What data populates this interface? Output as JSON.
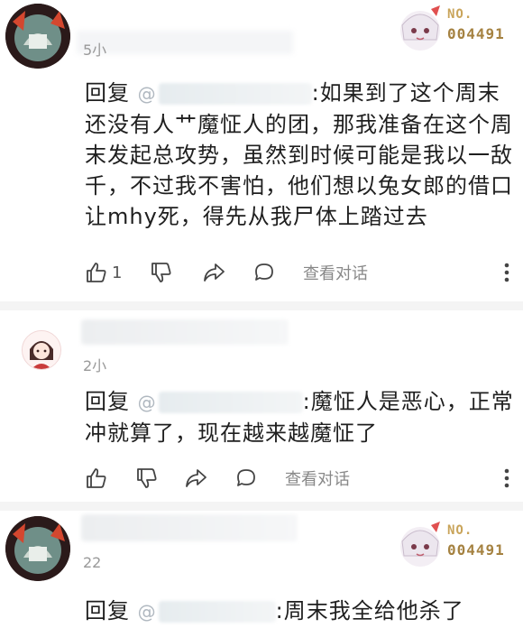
{
  "comments": [
    {
      "time": "5小",
      "badge": {
        "no": "NO.",
        "num": "004491"
      },
      "reply_prefix": "回复",
      "mention_sep": ":",
      "lines": [
        "如果到了这个周末",
        "还没有人艹魔怔人的团，那我准备在这个周",
        "末发起总攻势，虽然到时候可能是我以一敌",
        "千，不过我不害怕，他们想以兔女郎的借口",
        "让mhy死，得先从我尸体上踏过去"
      ],
      "like_count": "1",
      "view_dialog": "查看对话"
    },
    {
      "time": "2小",
      "reply_prefix": "回复",
      "mention_sep": ":",
      "lines": [
        "魔怔人是恶心，正常",
        "冲就算了，现在越来越魔怔了"
      ],
      "like_count": "",
      "view_dialog": "查看对话"
    },
    {
      "time": "22",
      "badge": {
        "no": "NO.",
        "num": "004491"
      },
      "reply_prefix": "回复",
      "mention_sep": ":",
      "lines": [
        "周末我全给他杀了"
      ]
    }
  ]
}
